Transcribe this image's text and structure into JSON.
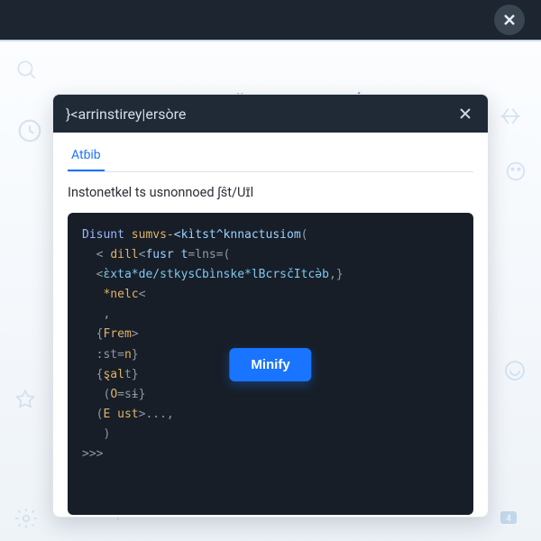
{
  "header": {
    "close_title": "Close"
  },
  "heading": "MEEDThə̀ə̌18̀yCONEdexɜ̀ ĺ:...",
  "panel": {
    "title": "}<arrinstirey|ersòre",
    "close_title": "Close",
    "tabs": [
      {
        "label": "Atɓib",
        "active": true
      }
    ],
    "field_label": "Instonetkel ts usnonnoed ∫ŝt/Uɪ̄l",
    "code": {
      "line1_a": "Disunt ",
      "line1_b": "sumvs-",
      "line1_c": "<kìtst^knnactusiom",
      "line1_d": "(",
      "line2_a": "  < ",
      "line2_b": "dill",
      "line2_c": "<",
      "line2_d": "fusr t",
      "line2_e": "=lns=(",
      "line3_a": "  <",
      "line3_b": "ɛ̀xta*de/stkysCbìnske*lBcrsčItcə̀b",
      "line3_c": ",}",
      "line4_a": "   *nelc",
      "line4_b": "<",
      "line5_a": "   ,",
      "line6_a": "  {",
      "line6_b": "Frem",
      "line6_c": ">",
      "line7_a": "  :st=",
      "line7_b": "n",
      "line7_c": "}",
      "line8_a": "  {",
      "line8_b": "ȿal",
      "line8_c": "t}",
      "line9_a": "   (",
      "line9_b": "O",
      "line9_c": "=sɨ}",
      "line10_a": "  (",
      "line10_b": "E ust",
      "line10_c": ">...,",
      "line11_a": "   )",
      "line12_a": ">>>"
    },
    "minify_button": "Minify"
  }
}
